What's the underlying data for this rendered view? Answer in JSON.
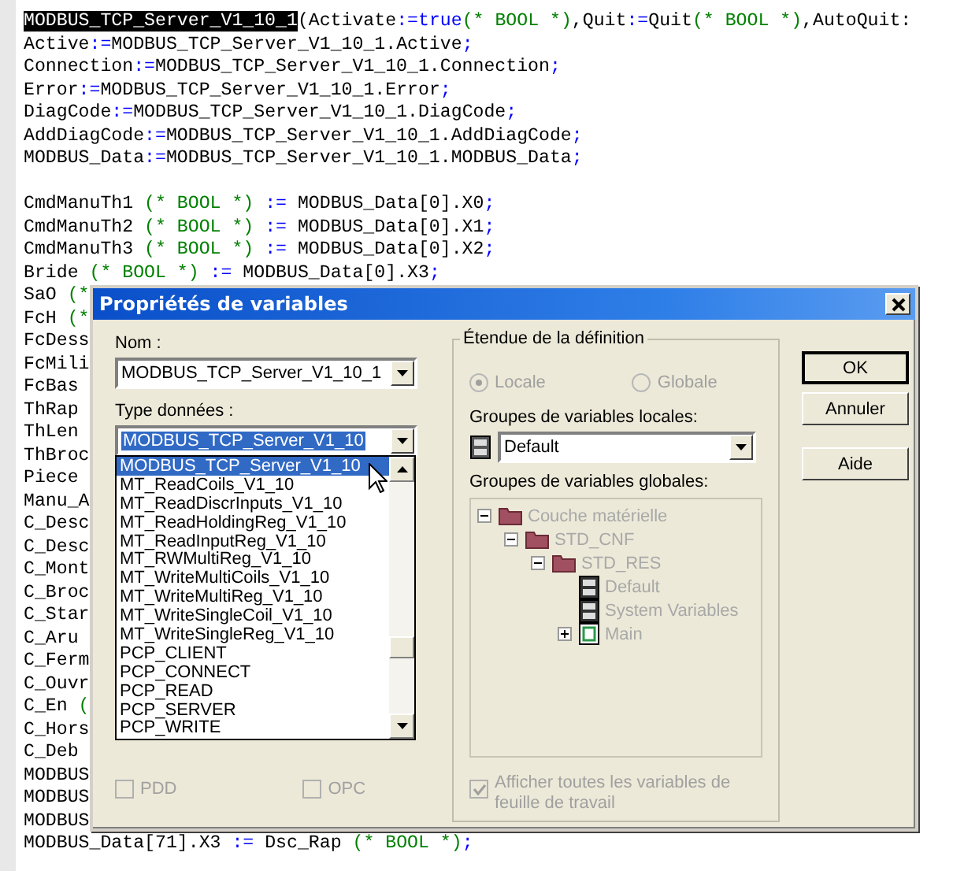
{
  "editor": {
    "blocks": [
      {
        "lines": [
          {
            "segments": [
              {
                "text": "MODBUS_TCP_Server_V1_10_1",
                "kind": "selected"
              },
              {
                "text": "(Activate",
                "kind": "plain"
              },
              {
                "text": ":=",
                "kind": "op"
              },
              {
                "text": "true",
                "kind": "keyword"
              },
              {
                "text": "(* BOOL *)",
                "kind": "comment"
              },
              {
                "text": ",Quit",
                "kind": "plain"
              },
              {
                "text": ":=",
                "kind": "op"
              },
              {
                "text": "Quit",
                "kind": "plain"
              },
              {
                "text": "(* BOOL *)",
                "kind": "comment"
              },
              {
                "text": ",AutoQuit:",
                "kind": "plain"
              }
            ]
          },
          {
            "segments": [
              {
                "text": "Active",
                "kind": "plain"
              },
              {
                "text": ":=",
                "kind": "op"
              },
              {
                "text": "MODBUS_TCP_Server_V1_10_1.Active",
                "kind": "plain"
              },
              {
                "text": ";",
                "kind": "op"
              }
            ]
          },
          {
            "segments": [
              {
                "text": "Connection",
                "kind": "plain"
              },
              {
                "text": ":=",
                "kind": "op"
              },
              {
                "text": "MODBUS_TCP_Server_V1_10_1.Connection",
                "kind": "plain"
              },
              {
                "text": ";",
                "kind": "op"
              }
            ]
          },
          {
            "segments": [
              {
                "text": "Error",
                "kind": "plain"
              },
              {
                "text": ":=",
                "kind": "op"
              },
              {
                "text": "MODBUS_TCP_Server_V1_10_1.Error",
                "kind": "plain"
              },
              {
                "text": ";",
                "kind": "op"
              }
            ]
          },
          {
            "segments": [
              {
                "text": "DiagCode",
                "kind": "plain"
              },
              {
                "text": ":=",
                "kind": "op"
              },
              {
                "text": "MODBUS_TCP_Server_V1_10_1.DiagCode",
                "kind": "plain"
              },
              {
                "text": ";",
                "kind": "op"
              }
            ]
          },
          {
            "segments": [
              {
                "text": "AddDiagCode",
                "kind": "plain"
              },
              {
                "text": ":=",
                "kind": "op"
              },
              {
                "text": "MODBUS_TCP_Server_V1_10_1.AddDiagCode",
                "kind": "plain"
              },
              {
                "text": ";",
                "kind": "op"
              }
            ]
          },
          {
            "segments": [
              {
                "text": "MODBUS_Data",
                "kind": "plain"
              },
              {
                "text": ":=",
                "kind": "op"
              },
              {
                "text": "MODBUS_TCP_Server_V1_10_1.MODBUS_Data",
                "kind": "plain"
              },
              {
                "text": ";",
                "kind": "op"
              }
            ]
          }
        ]
      },
      {
        "lines": [
          {
            "segments": [
              {
                "text": "CmdManuTh1 ",
                "kind": "plain"
              },
              {
                "text": "(* BOOL *) ",
                "kind": "comment"
              },
              {
                "text": ":=",
                "kind": "op"
              },
              {
                "text": " MODBUS_Data[0].X0",
                "kind": "plain"
              },
              {
                "text": ";",
                "kind": "op"
              }
            ]
          },
          {
            "segments": [
              {
                "text": "CmdManuTh2 ",
                "kind": "plain"
              },
              {
                "text": "(* BOOL *) ",
                "kind": "comment"
              },
              {
                "text": ":=",
                "kind": "op"
              },
              {
                "text": " MODBUS_Data[0].X1",
                "kind": "plain"
              },
              {
                "text": ";",
                "kind": "op"
              }
            ]
          },
          {
            "segments": [
              {
                "text": "CmdManuTh3 ",
                "kind": "plain"
              },
              {
                "text": "(* BOOL *) ",
                "kind": "comment"
              },
              {
                "text": ":=",
                "kind": "op"
              },
              {
                "text": " MODBUS_Data[0].X2",
                "kind": "plain"
              },
              {
                "text": ";",
                "kind": "op"
              }
            ]
          },
          {
            "segments": [
              {
                "text": "Bride ",
                "kind": "plain"
              },
              {
                "text": "(* BOOL *) ",
                "kind": "comment"
              },
              {
                "text": ":=",
                "kind": "op"
              },
              {
                "text": " MODBUS_Data[0].X3",
                "kind": "plain"
              },
              {
                "text": ";",
                "kind": "op"
              }
            ]
          },
          {
            "segments": [
              {
                "text": "SaO ",
                "kind": "plain"
              },
              {
                "text": "(*",
                "kind": "comment"
              }
            ]
          },
          {
            "segments": [
              {
                "text": "FcH ",
                "kind": "plain"
              },
              {
                "text": "(*",
                "kind": "comment"
              }
            ]
          },
          {
            "segments": [
              {
                "text": "FcDess",
                "kind": "plain"
              }
            ]
          },
          {
            "segments": [
              {
                "text": "FcMili",
                "kind": "plain"
              }
            ]
          },
          {
            "segments": [
              {
                "text": "FcBas",
                "kind": "plain"
              }
            ]
          },
          {
            "segments": [
              {
                "text": "ThRap",
                "kind": "plain"
              }
            ]
          },
          {
            "segments": [
              {
                "text": "ThLen",
                "kind": "plain"
              }
            ]
          },
          {
            "segments": [
              {
                "text": "ThBroc",
                "kind": "plain"
              }
            ]
          },
          {
            "segments": [
              {
                "text": "Piece",
                "kind": "plain"
              }
            ]
          },
          {
            "segments": [
              {
                "text": "Manu_A",
                "kind": "plain"
              }
            ]
          },
          {
            "segments": [
              {
                "text": "C_Desc",
                "kind": "plain"
              }
            ]
          },
          {
            "segments": [
              {
                "text": "C_Desc",
                "kind": "plain"
              }
            ]
          },
          {
            "segments": [
              {
                "text": "C_Mont",
                "kind": "plain"
              }
            ]
          },
          {
            "segments": [
              {
                "text": "C_Broc",
                "kind": "plain"
              }
            ]
          },
          {
            "segments": [
              {
                "text": "C_Star",
                "kind": "plain"
              }
            ]
          },
          {
            "segments": [
              {
                "text": "C_Aru",
                "kind": "plain"
              }
            ]
          },
          {
            "segments": [
              {
                "text": "C_Ferm",
                "kind": "plain"
              }
            ]
          },
          {
            "segments": [
              {
                "text": "C_Ouvr",
                "kind": "plain"
              }
            ]
          },
          {
            "segments": [
              {
                "text": "C_En ",
                "kind": "plain"
              },
              {
                "text": "(",
                "kind": "comment"
              }
            ]
          },
          {
            "segments": [
              {
                "text": "C_Hors",
                "kind": "plain"
              }
            ]
          },
          {
            "segments": [
              {
                "text": "C_Deb",
                "kind": "plain"
              }
            ]
          },
          {
            "segments": [
              {
                "text": "MODBUS",
                "kind": "plain"
              }
            ]
          },
          {
            "segments": [
              {
                "text": "MODBUS",
                "kind": "plain"
              }
            ]
          },
          {
            "segments": [
              {
                "text": "MODBUS",
                "kind": "plain"
              }
            ]
          },
          {
            "segments": [
              {
                "text": "MODBUS_Data[71].X3 ",
                "kind": "plain"
              },
              {
                "text": ":=",
                "kind": "op"
              },
              {
                "text": " Dsc_Rap ",
                "kind": "plain"
              },
              {
                "text": "(* BOOL *)",
                "kind": "comment"
              },
              {
                "text": ";",
                "kind": "op"
              }
            ]
          }
        ]
      }
    ]
  },
  "dialog": {
    "title": "Propriétés de variables",
    "name_label": "Nom :",
    "name_value": "MODBUS_TCP_Server_V1_10_1",
    "type_label": "Type données :",
    "type_value": "MODBUS_TCP_Server_V1_10",
    "type_list": [
      {
        "label": "MODBUS_TCP_Server_V1_10",
        "selected": true
      },
      {
        "label": "MT_ReadCoils_V1_10",
        "selected": false
      },
      {
        "label": "MT_ReadDiscrInputs_V1_10",
        "selected": false
      },
      {
        "label": "MT_ReadHoldingReg_V1_10",
        "selected": false
      },
      {
        "label": "MT_ReadInputReg_V1_10",
        "selected": false
      },
      {
        "label": "MT_RWMultiReg_V1_10",
        "selected": false
      },
      {
        "label": "MT_WriteMultiCoils_V1_10",
        "selected": false
      },
      {
        "label": "MT_WriteMultiReg_V1_10",
        "selected": false
      },
      {
        "label": "MT_WriteSingleCoil_V1_10",
        "selected": false
      },
      {
        "label": "MT_WriteSingleReg_V1_10",
        "selected": false
      },
      {
        "label": "PCP_CLIENT",
        "selected": false
      },
      {
        "label": "PCP_CONNECT",
        "selected": false
      },
      {
        "label": "PCP_READ",
        "selected": false
      },
      {
        "label": "PCP_SERVER",
        "selected": false
      },
      {
        "label": "PCP_WRITE",
        "selected": false
      }
    ],
    "options": [
      {
        "label": "PDD",
        "checked": false,
        "disabled": true
      },
      {
        "label": "OPC",
        "checked": false,
        "disabled": true
      }
    ],
    "scope": {
      "title": "Étendue de la définition",
      "radios": [
        {
          "label": "Locale",
          "selected": true,
          "disabled": true
        },
        {
          "label": "Globale",
          "selected": false,
          "disabled": true
        }
      ],
      "local_groups_label": "Groupes de variables locales:",
      "local_group_value": "Default",
      "global_groups_label": "Groupes de variables globales:",
      "tree_disabled": true,
      "tree": [
        {
          "label": "Couche matérielle",
          "kind": "folder",
          "expanded": true,
          "children": [
            {
              "label": "STD_CNF",
              "kind": "folder",
              "expanded": true,
              "children": [
                {
                  "label": "STD_RES",
                  "kind": "folder",
                  "expanded": true,
                  "children": [
                    {
                      "label": "Default",
                      "kind": "cabinet"
                    },
                    {
                      "label": "System Variables",
                      "kind": "cabinet"
                    },
                    {
                      "label": "Main",
                      "kind": "program",
                      "expanded": false
                    }
                  ]
                }
              ]
            }
          ]
        }
      ],
      "show_all": {
        "label": "Afficher toutes les variables de feuille de travail",
        "checked": true,
        "disabled": true
      }
    },
    "buttons": [
      {
        "label": "OK",
        "default": true
      },
      {
        "label": "Annuler",
        "default": false
      },
      {
        "label": "Aide",
        "default": false
      }
    ]
  }
}
